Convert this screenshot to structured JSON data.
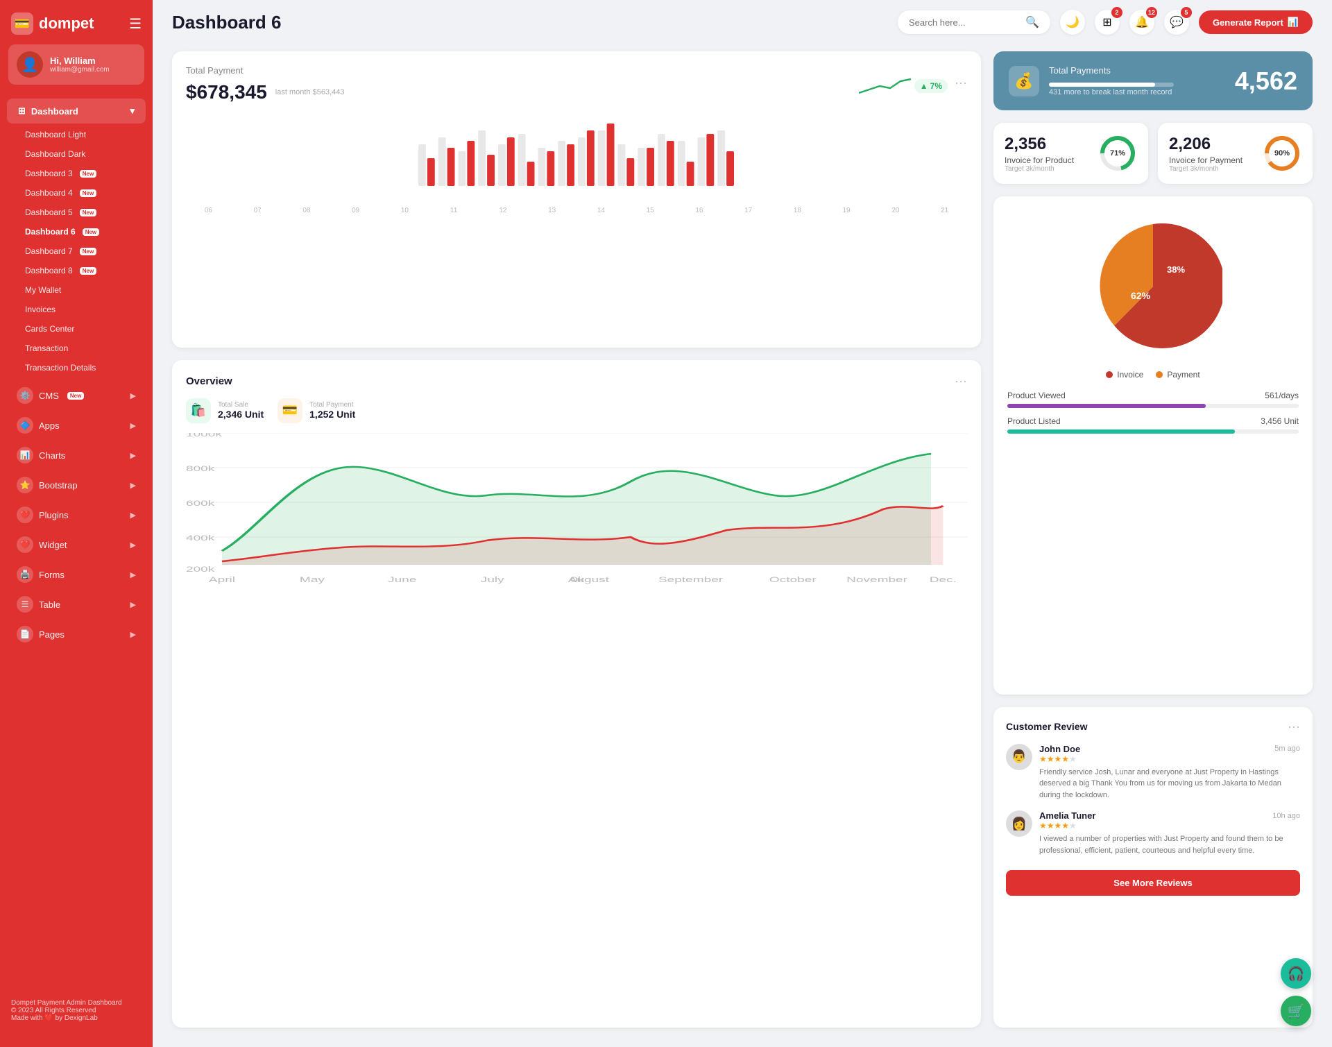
{
  "sidebar": {
    "logo": "dompet",
    "user": {
      "greeting": "Hi, William",
      "email": "william@gmail.com"
    },
    "dashboard_label": "Dashboard",
    "dashboard_items": [
      {
        "label": "Dashboard Light",
        "new": false,
        "active": false
      },
      {
        "label": "Dashboard Dark",
        "new": false,
        "active": false
      },
      {
        "label": "Dashboard 3",
        "new": true,
        "active": false
      },
      {
        "label": "Dashboard 4",
        "new": true,
        "active": false
      },
      {
        "label": "Dashboard 5",
        "new": true,
        "active": false
      },
      {
        "label": "Dashboard 6",
        "new": true,
        "active": true
      },
      {
        "label": "Dashboard 7",
        "new": true,
        "active": false
      },
      {
        "label": "Dashboard 8",
        "new": true,
        "active": false
      },
      {
        "label": "My Wallet",
        "new": false,
        "active": false
      },
      {
        "label": "Invoices",
        "new": false,
        "active": false
      },
      {
        "label": "Cards Center",
        "new": false,
        "active": false
      },
      {
        "label": "Transaction",
        "new": false,
        "active": false
      },
      {
        "label": "Transaction Details",
        "new": false,
        "active": false
      }
    ],
    "nav_items": [
      {
        "label": "CMS",
        "new": true,
        "icon": "⚙️"
      },
      {
        "label": "Apps",
        "new": false,
        "icon": "🔷"
      },
      {
        "label": "Charts",
        "new": false,
        "icon": "📊"
      },
      {
        "label": "Bootstrap",
        "new": false,
        "icon": "⭐"
      },
      {
        "label": "Plugins",
        "new": false,
        "icon": "❤️"
      },
      {
        "label": "Widget",
        "new": false,
        "icon": "❤️"
      },
      {
        "label": "Forms",
        "new": false,
        "icon": "🖨️"
      },
      {
        "label": "Table",
        "new": false,
        "icon": "☰"
      },
      {
        "label": "Pages",
        "new": false,
        "icon": "📄"
      }
    ],
    "footer": {
      "title": "Dompet Payment Admin Dashboard",
      "copyright": "© 2023 All Rights Reserved",
      "made_with": "Made with ❤️ by DexignLab"
    }
  },
  "topbar": {
    "title": "Dashboard 6",
    "search_placeholder": "Search here...",
    "generate_btn": "Generate Report",
    "notifications": {
      "apps_count": "2",
      "bell_count": "12",
      "message_count": "5"
    }
  },
  "total_payment": {
    "title": "Total Payment",
    "amount": "$678,345",
    "last_month_label": "last month $563,443",
    "trend": "7%",
    "dots": "···",
    "bars": [
      {
        "gray": 60,
        "red": 40
      },
      {
        "gray": 70,
        "red": 55
      },
      {
        "gray": 50,
        "red": 65
      },
      {
        "gray": 80,
        "red": 45
      },
      {
        "gray": 60,
        "red": 70
      },
      {
        "gray": 75,
        "red": 35
      },
      {
        "gray": 55,
        "red": 50
      },
      {
        "gray": 65,
        "red": 60
      },
      {
        "gray": 70,
        "red": 80
      },
      {
        "gray": 80,
        "red": 90
      },
      {
        "gray": 60,
        "red": 40
      },
      {
        "gray": 55,
        "red": 55
      },
      {
        "gray": 75,
        "red": 65
      },
      {
        "gray": 65,
        "red": 35
      },
      {
        "gray": 70,
        "red": 75
      },
      {
        "gray": 80,
        "red": 50
      }
    ],
    "x_labels": [
      "06",
      "07",
      "08",
      "09",
      "10",
      "11",
      "12",
      "13",
      "14",
      "15",
      "16",
      "17",
      "18",
      "19",
      "20",
      "21"
    ]
  },
  "total_payments_banner": {
    "title": "Total Payments",
    "sub": "431 more to break last month record",
    "number": "4,562"
  },
  "invoice_product": {
    "number": "2,356",
    "label": "Invoice for Product",
    "sub": "Target 3k/month",
    "percent": 71,
    "color": "#27ae60"
  },
  "invoice_payment": {
    "number": "2,206",
    "label": "Invoice for Payment",
    "sub": "Target 3k/month",
    "percent": 90,
    "color": "#e67e22"
  },
  "overview": {
    "title": "Overview",
    "dots": "···",
    "total_sale": {
      "label": "Total Sale",
      "value": "2,346 Unit",
      "color": "#27ae60"
    },
    "total_payment": {
      "label": "Total Payment",
      "value": "1,252 Unit",
      "color": "#e67e22"
    },
    "x_labels": [
      "April",
      "May",
      "June",
      "July",
      "August",
      "September",
      "October",
      "November",
      "Dec."
    ]
  },
  "pie_chart": {
    "invoice_pct": 62,
    "payment_pct": 38,
    "invoice_label": "Invoice",
    "payment_label": "Payment",
    "invoice_color": "#c0392b",
    "payment_color": "#e67e22"
  },
  "product_stats": {
    "viewed": {
      "label": "Product Viewed",
      "value": "561/days",
      "fill_pct": 68,
      "color": "#8e44ad"
    },
    "listed": {
      "label": "Product Listed",
      "value": "3,456 Unit",
      "fill_pct": 78,
      "color": "#1abc9c"
    }
  },
  "customer_review": {
    "title": "Customer Review",
    "dots": "···",
    "reviews": [
      {
        "name": "John Doe",
        "time": "5m ago",
        "stars": 4,
        "text": "Friendly service Josh, Lunar and everyone at Just Property in Hastings deserved a big Thank You from us for moving us from Jakarta to Medan during the lockdown."
      },
      {
        "name": "Amelia Tuner",
        "time": "10h ago",
        "stars": 4,
        "text": "I viewed a number of properties with Just Property and found them to be professional, efficient, patient, courteous and helpful every time."
      }
    ],
    "see_more_btn": "See More Reviews"
  },
  "float_btns": {
    "headset": "🎧",
    "cart": "🛒"
  }
}
